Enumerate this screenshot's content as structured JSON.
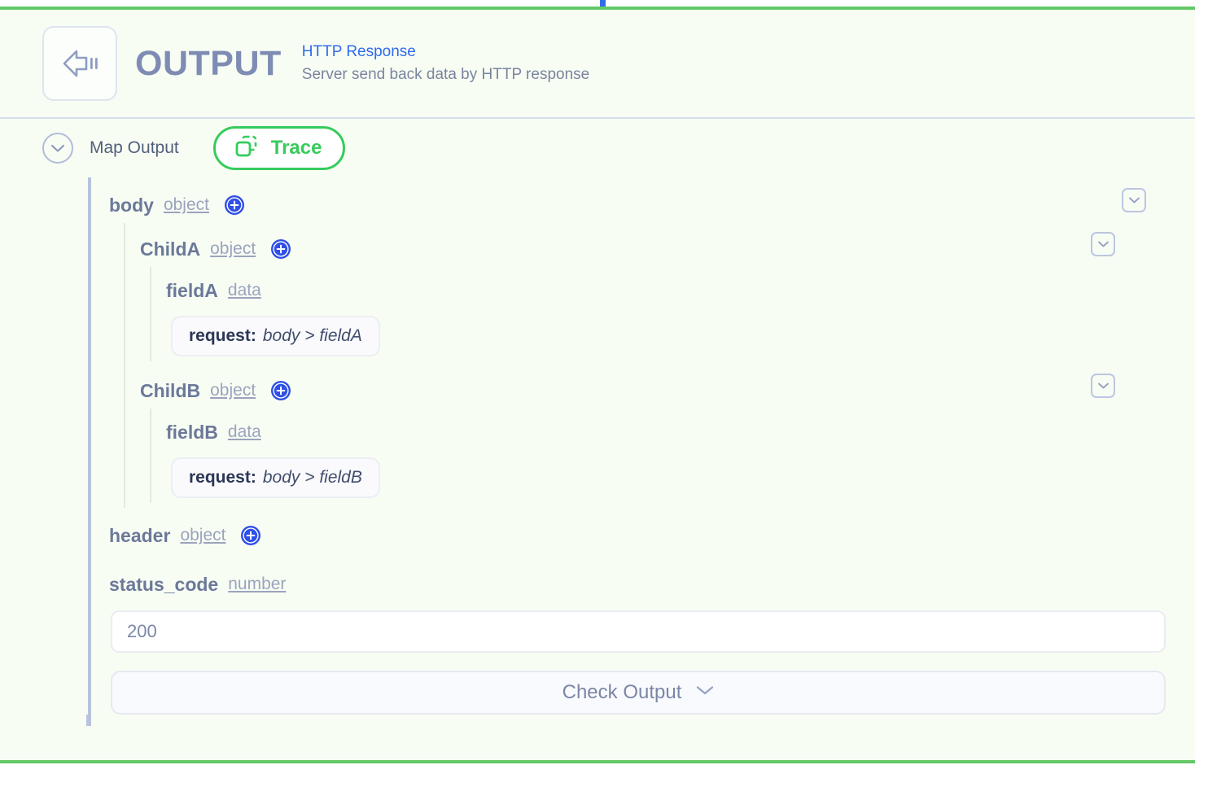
{
  "colors": {
    "accent_green": "#36cc5c",
    "card_border_green": "#63c965",
    "link_blue": "#2f6bed",
    "connector_blue": "#2f6bed",
    "title_slate": "#7e8cb4",
    "muted_text": "#79859e"
  },
  "header": {
    "icon": "output-arrow-icon",
    "title": "OUTPUT",
    "link_label": "HTTP Response",
    "subtitle": "Server send back data by HTTP response"
  },
  "toolbar": {
    "expand_icon": "chevron-down-icon",
    "map_output_label": "Map Output",
    "trace_icon": "copy-icon",
    "trace_label": "Trace"
  },
  "tree": {
    "body": {
      "name": "body",
      "type": "object",
      "add_icon": "plus-circle-icon",
      "collapse_icon": "chevron-down-icon",
      "children": [
        {
          "name": "ChildA",
          "type": "object",
          "add_icon": "plus-circle-icon",
          "collapse_icon": "chevron-down-icon",
          "fields": [
            {
              "name": "fieldA",
              "type": "data",
              "chip_key": "request:",
              "chip_value": "body > fieldA"
            }
          ]
        },
        {
          "name": "ChildB",
          "type": "object",
          "add_icon": "plus-circle-icon",
          "collapse_icon": "chevron-down-icon",
          "fields": [
            {
              "name": "fieldB",
              "type": "data",
              "chip_key": "request:",
              "chip_value": "body > fieldB"
            }
          ]
        }
      ]
    },
    "header_node": {
      "name": "header",
      "type": "object",
      "add_icon": "plus-circle-icon"
    },
    "status_code": {
      "name": "status_code",
      "type": "number",
      "value": "200",
      "placeholder": "200"
    }
  },
  "footer": {
    "check_output_label": "Check Output",
    "check_output_icon": "chevron-down-icon"
  }
}
